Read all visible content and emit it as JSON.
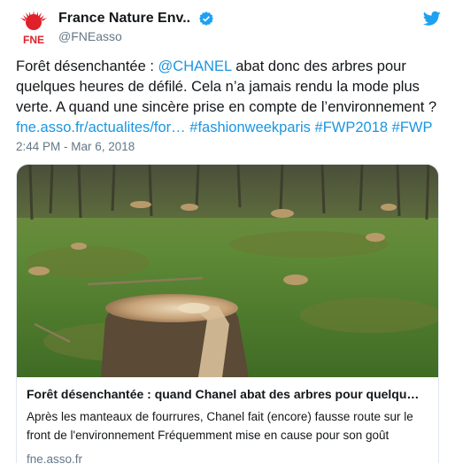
{
  "account": {
    "display_name": "France Nature Env..",
    "handle": "@FNEasso",
    "avatar_text": "FNE"
  },
  "tweet": {
    "text_1": "Forêt désenchantée : ",
    "mention": "@CHANEL",
    "text_2": " abat donc des arbres pour quelques heures de défilé. Cela n’a jamais rendu la mode plus verte. A quand une sincère prise en compte de l’environnement ?",
    "link": "fne.asso.fr/actualites/for…",
    "hashtags": [
      "#fashionweekparis",
      "#FWP2018",
      "#FWP"
    ],
    "timestamp": "2:44 PM - Mar 6, 2018"
  },
  "card": {
    "title": "Forêt désenchantée : quand Chanel abat des arbres pour quelqu…",
    "description": "Après les manteaux de fourrures, Chanel fait (encore) fausse route sur le front de l'environnement Fréquemment mise en cause pour son goût",
    "domain": "fne.asso.fr"
  },
  "colors": {
    "link": "#1b95e0",
    "verified": "#1da1f2",
    "twitter_bird": "#1da1f2",
    "avatar_red": "#e0202a"
  }
}
